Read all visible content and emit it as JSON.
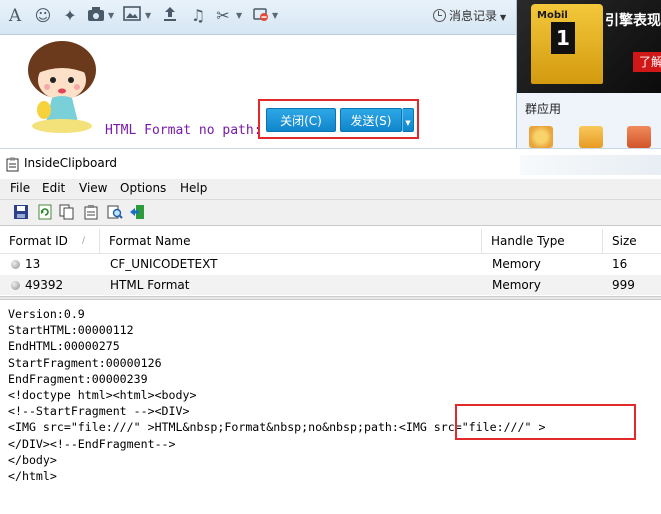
{
  "qq_window": {
    "toolbar": {
      "icons": [
        "font-icon",
        "emoji-icon",
        "magic-icon",
        "screenshot-icon",
        "image-icon",
        "upload-icon",
        "music-icon",
        "scissors-icon",
        "block-icon"
      ],
      "message_history": "消息记录"
    },
    "input_text": "HTML Format no path:",
    "buttons": {
      "close": "关闭(C)",
      "send": "发送(S)"
    },
    "side_panel": {
      "ad": {
        "brand": "Mobil",
        "number": "1",
        "text": "引擎表现",
        "button": "了解"
      },
      "group_apps_label": "群应用"
    }
  },
  "inside_clipboard": {
    "title": "InsideClipboard",
    "menu": [
      "File",
      "Edit",
      "View",
      "Options",
      "Help"
    ],
    "toolbar_icons": [
      "save-icon",
      "refresh-icon",
      "copy-icon",
      "properties-icon",
      "find-icon",
      "exit-icon"
    ],
    "columns": [
      "Format ID",
      "Format Name",
      "Handle Type",
      "Size"
    ],
    "rows": [
      {
        "id": "13",
        "name": "CF_UNICODETEXT",
        "handle": "Memory",
        "size": "16"
      },
      {
        "id": "49392",
        "name": "HTML Format",
        "handle": "Memory",
        "size": "999"
      }
    ],
    "raw_content": "Version:0.9\nStartHTML:00000112\nEndHTML:00000275\nStartFragment:00000126\nEndFragment:00000239\n<!doctype html><html><body>\n<!--StartFragment --><DIV>\n<IMG src=\"file:///\" >HTML&nbsp;Format&nbsp;no&nbsp;path:<IMG src=\"file:///\" >\n</DIV><!--EndFragment-->\n</body>\n</html>"
  },
  "colors": {
    "highlight": "#e32a2a",
    "qq_button": "#1a92d6",
    "input_text": "#7a1aa8"
  }
}
